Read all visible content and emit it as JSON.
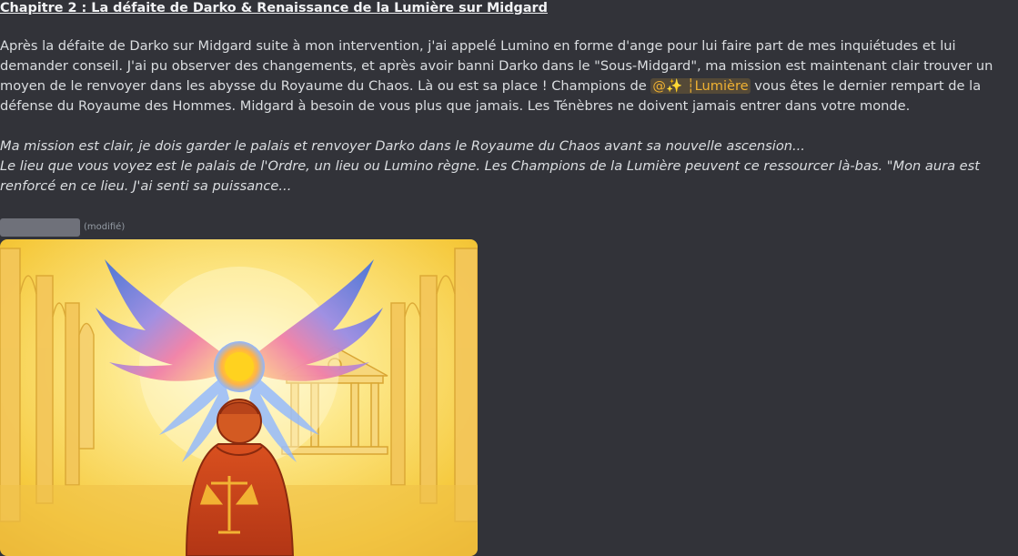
{
  "message": {
    "title": "Chapitre 2 : La défaite de Darko & Renaissance de la Lumière sur Midgard",
    "para1_a": "Après la défaite de Darko sur Midgard suite à mon intervention, j'ai appelé Lumino en forme d'ange pour lui faire part de mes inquiétudes et lui demander conseil. J'ai pu observer des changements, et après avoir banni Darko dans le \"Sous-Midgard\", ma mission est maintenant clair trouver un moyen de le renvoyer dans les abysse du Royaume du Chaos. Là ou est sa place ! Champions de ",
    "role_mention": "@✨ ┆Lumière",
    "para1_b": " vous êtes le dernier rempart de la défense du Royaume des Hommes. Midgard à besoin de vous plus que jamais. Les Ténèbres ne doivent jamais entrer dans votre monde.",
    "italic1": "Ma mission est clair, je dois garder le palais et renvoyer Darko dans le Royaume du Chaos avant sa nouvelle ascension...",
    "italic2": "Le lieu que vous voyez est le palais de l'Ordre, un lieu ou Lumino règne. Les Champions de la  Lumière peuvent ce ressourcer là-bas. \"Mon aura est renforcé en ce lieu. J'ai senti sa puissance..."
  },
  "meta": {
    "edited_label": "(modifié)"
  },
  "colors": {
    "background": "#323339",
    "text": "#dbdee1",
    "mention": "#f0b132",
    "cloak": "#c43d1a"
  },
  "attachment": {
    "icons": [
      "angel-wings",
      "sun-orb",
      "scales-of-justice",
      "palace-columns"
    ]
  }
}
